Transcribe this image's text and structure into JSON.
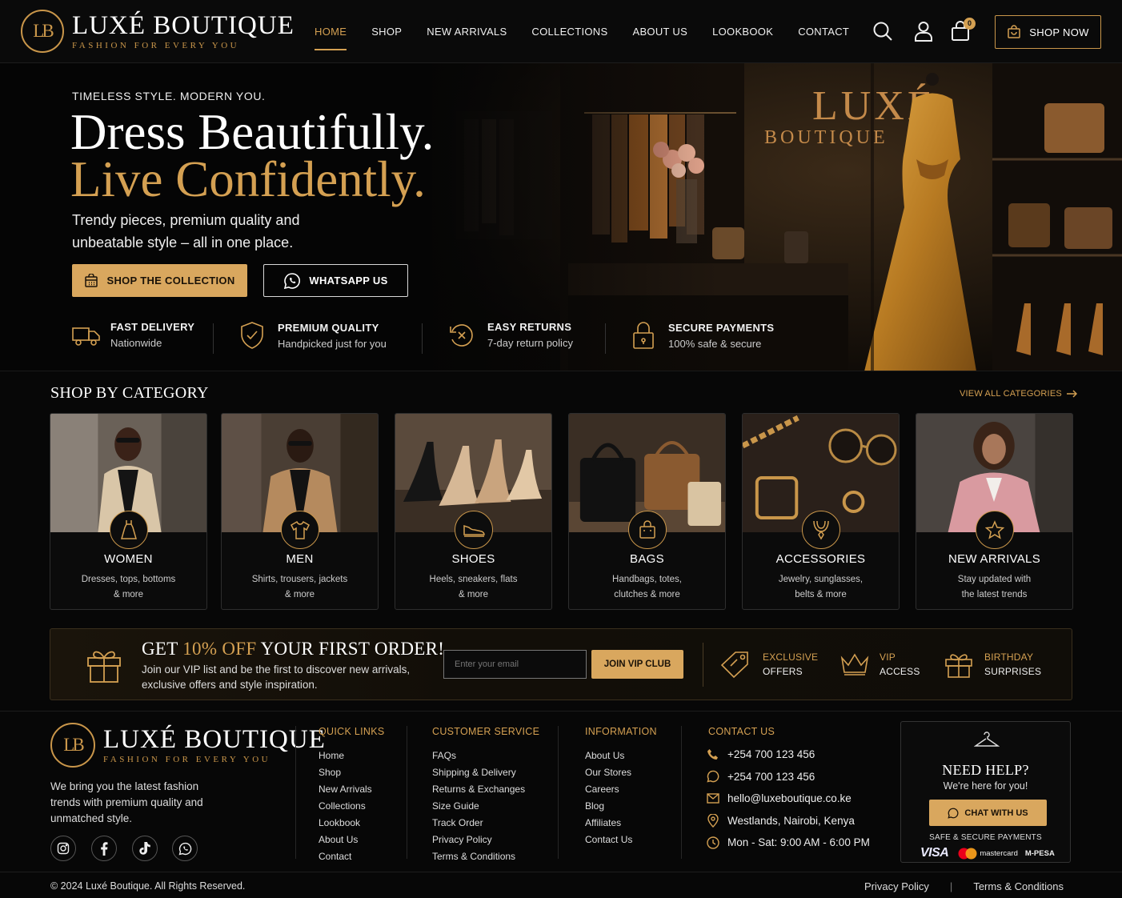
{
  "brand": {
    "name": "LUXÉ BOUTIQUE",
    "tagline": "FASHION FOR EVERY YOU",
    "monogram": "LB",
    "accent": "#d4a052"
  },
  "nav": {
    "items": [
      "HOME",
      "SHOP",
      "NEW ARRIVALS",
      "COLLECTIONS",
      "ABOUT US",
      "LOOKBOOK",
      "CONTACT"
    ],
    "active": "HOME"
  },
  "header": {
    "cart_count": "0",
    "shop_now": "SHOP NOW",
    "icons": [
      "search-icon",
      "user-icon",
      "bag-icon"
    ]
  },
  "hero": {
    "eyebrow": "TIMELESS STYLE. MODERN YOU.",
    "headline1": "Dress Beautifully.",
    "headline2": "Live Confidently.",
    "subtitle": "Trendy pieces, premium quality and unbeatable style – all in one place.",
    "primary_button": "SHOP THE COLLECTION",
    "secondary_button": "WHATSAPP US",
    "sign_word1": "LUXÉ",
    "sign_word2": "BOUTIQUE",
    "features": [
      {
        "title": "FAST DELIVERY",
        "subtitle": "Nationwide",
        "icon": "truck-icon"
      },
      {
        "title": "PREMIUM QUALITY",
        "subtitle": "Handpicked just for you",
        "icon": "shield-check-icon"
      },
      {
        "title": "EASY RETURNS",
        "subtitle": "7-day return policy",
        "icon": "return-icon"
      },
      {
        "title": "SECURE PAYMENTS",
        "subtitle": "100% safe & secure",
        "icon": "lock-icon"
      }
    ]
  },
  "categories": {
    "title": "SHOP BY CATEGORY",
    "view_all": "VIEW ALL CATEGORIES",
    "items": [
      {
        "name": "WOMEN",
        "desc1": "Dresses, tops, bottoms",
        "desc2": "& more"
      },
      {
        "name": "MEN",
        "desc1": "Shirts, trousers, jackets",
        "desc2": "& more"
      },
      {
        "name": "SHOES",
        "desc1": "Heels, sneakers, flats",
        "desc2": "& more"
      },
      {
        "name": "BAGS",
        "desc1": "Handbags, totes,",
        "desc2": "clutches & more"
      },
      {
        "name": "ACCESSORIES",
        "desc1": "Jewelry, sunglasses,",
        "desc2": "belts & more"
      },
      {
        "name": "NEW ARRIVALS",
        "desc1": "Stay updated with",
        "desc2": "the latest trends"
      }
    ]
  },
  "promo": {
    "title_pre": "GET ",
    "title_highlight": "10% OFF",
    "title_post": " YOUR FIRST ORDER!",
    "subtitle": "Join our VIP list and be the first to discover new arrivals, exclusive offers and style inspiration.",
    "email_placeholder": "Enter your email",
    "join_button": "JOIN VIP CLUB",
    "perks": [
      {
        "line1": "EXCLUSIVE",
        "line2": "OFFERS"
      },
      {
        "line1": "VIP",
        "line2": "ACCESS"
      },
      {
        "line1": "BIRTHDAY",
        "line2": "SURPRISES"
      }
    ]
  },
  "footer": {
    "description": "We bring you the latest fashion trends with premium quality and unmatched style.",
    "quick_links": {
      "title": "QUICK LINKS",
      "items": [
        "Home",
        "Shop",
        "New Arrivals",
        "Collections",
        "Lookbook",
        "About Us",
        "Contact"
      ]
    },
    "customer_service": {
      "title": "CUSTOMER SERVICE",
      "items": [
        "FAQs",
        "Shipping & Delivery",
        "Returns & Exchanges",
        "Size Guide",
        "Track Order",
        "Privacy Policy",
        "Terms & Conditions"
      ]
    },
    "information": {
      "title": "INFORMATION",
      "items": [
        "About Us",
        "Our Stores",
        "Careers",
        "Blog",
        "Affiliates",
        "Contact Us"
      ]
    },
    "contact": {
      "title": "CONTACT US",
      "phone": "+254 700 123 456",
      "whatsapp": "+254 700 123 456",
      "email": "hello@luxeboutique.co.ke",
      "address": "Westlands, Nairobi, Kenya",
      "hours": "Mon - Sat: 9:00 AM - 6:00 PM"
    },
    "help": {
      "title": "NEED HELP?",
      "subtitle": "We're here for you!",
      "button": "CHAT WITH US",
      "secure": "SAFE & SECURE PAYMENTS",
      "payments": [
        "VISA",
        "mastercard",
        "M-PESA"
      ]
    },
    "copyright": "© 2024 Luxé Boutique. All Rights Reserved.",
    "bottom_links": [
      "Privacy Policy",
      "Terms & Conditions"
    ]
  }
}
